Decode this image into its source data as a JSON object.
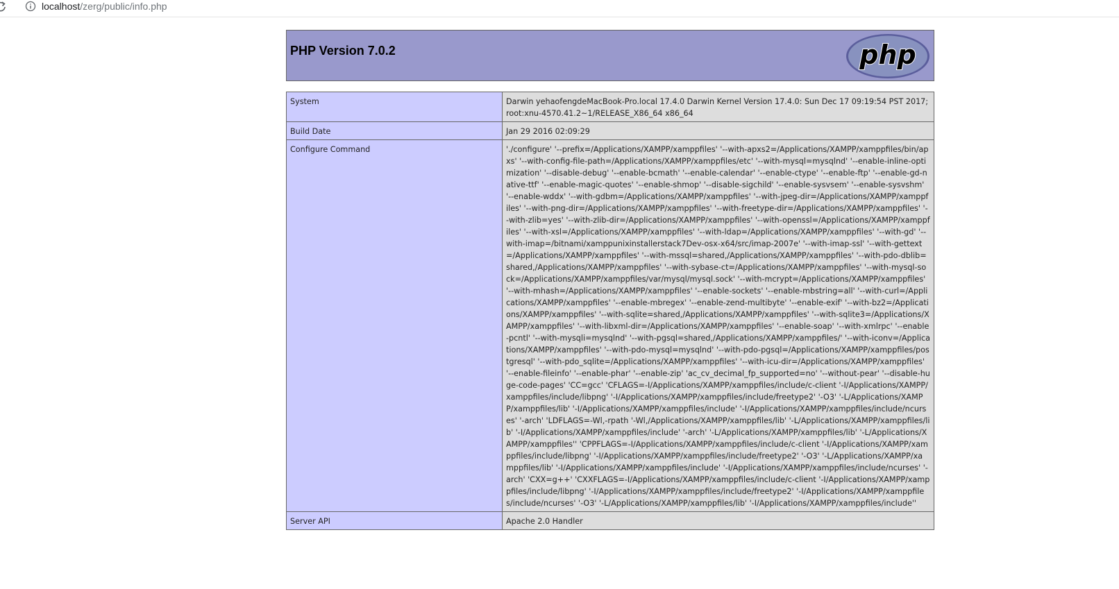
{
  "browser": {
    "url_host": "localhost",
    "url_path": "/zerg/public/info.php"
  },
  "header": {
    "title": "PHP Version 7.0.2",
    "logo_text": "php"
  },
  "rows": [
    {
      "key": "System",
      "value": "Darwin yehaofengdeMacBook-Pro.local 17.4.0 Darwin Kernel Version 17.4.0: Sun Dec 17 09:19:54 PST 2017; root:xnu-4570.41.2~1/RELEASE_X86_64 x86_64"
    },
    {
      "key": "Build Date",
      "value": "Jan 29 2016 02:09:29"
    },
    {
      "key": "Configure Command",
      "value": "'./configure' '--prefix=/Applications/XAMPP/xamppfiles' '--with-apxs2=/Applications/XAMPP/xamppfiles/bin/apxs' '--with-config-file-path=/Applications/XAMPP/xamppfiles/etc' '--with-mysql=mysqlnd' '--enable-inline-optimization' '--disable-debug' '--enable-bcmath' '--enable-calendar' '--enable-ctype' '--enable-ftp' '--enable-gd-native-ttf' '--enable-magic-quotes' '--enable-shmop' '--disable-sigchild' '--enable-sysvsem' '--enable-sysvshm' '--enable-wddx' '--with-gdbm=/Applications/XAMPP/xamppfiles' '--with-jpeg-dir=/Applications/XAMPP/xamppfiles' '--with-png-dir=/Applications/XAMPP/xamppfiles' '--with-freetype-dir=/Applications/XAMPP/xamppfiles' '--with-zlib=yes' '--with-zlib-dir=/Applications/XAMPP/xamppfiles' '--with-openssl=/Applications/XAMPP/xamppfiles' '--with-xsl=/Applications/XAMPP/xamppfiles' '--with-ldap=/Applications/XAMPP/xamppfiles' '--with-gd' '--with-imap=/bitnami/xamppunixinstallerstack7Dev-osx-x64/src/imap-2007e' '--with-imap-ssl' '--with-gettext=/Applications/XAMPP/xamppfiles' '--with-mssql=shared,/Applications/XAMPP/xamppfiles' '--with-pdo-dblib=shared,/Applications/XAMPP/xamppfiles' '--with-sybase-ct=/Applications/XAMPP/xamppfiles' '--with-mysql-sock=/Applications/XAMPP/xamppfiles/var/mysql/mysql.sock' '--with-mcrypt=/Applications/XAMPP/xamppfiles' '--with-mhash=/Applications/XAMPP/xamppfiles' '--enable-sockets' '--enable-mbstring=all' '--with-curl=/Applications/XAMPP/xamppfiles' '--enable-mbregex' '--enable-zend-multibyte' '--enable-exif' '--with-bz2=/Applications/XAMPP/xamppfiles' '--with-sqlite=shared,/Applications/XAMPP/xamppfiles' '--with-sqlite3=/Applications/XAMPP/xamppfiles' '--with-libxml-dir=/Applications/XAMPP/xamppfiles' '--enable-soap' '--with-xmlrpc' '--enable-pcntl' '--with-mysqli=mysqlnd' '--with-pgsql=shared,/Applications/XAMPP/xamppfiles/' '--with-iconv=/Applications/XAMPP/xamppfiles' '--with-pdo-mysql=mysqlnd' '--with-pdo-pgsql=/Applications/XAMPP/xamppfiles/postgresql' '--with-pdo_sqlite=/Applications/XAMPP/xamppfiles' '--with-icu-dir=/Applications/XAMPP/xamppfiles' '--enable-fileinfo' '--enable-phar' '--enable-zip' 'ac_cv_decimal_fp_supported=no' '--without-pear' '--disable-huge-code-pages' 'CC=gcc' 'CFLAGS=-I/Applications/XAMPP/xamppfiles/include/c-client '-I/Applications/XAMPP/xamppfiles/include/libpng' '-I/Applications/XAMPP/xamppfiles/include/freetype2' '-O3' '-L/Applications/XAMPP/xamppfiles/lib' '-I/Applications/XAMPP/xamppfiles/include' '-I/Applications/XAMPP/xamppfiles/include/ncurses' '-arch' 'LDFLAGS=-Wl,-rpath '-Wl,/Applications/XAMPP/xamppfiles/lib' '-L/Applications/XAMPP/xamppfiles/lib' '-I/Applications/XAMPP/xamppfiles/include' '-arch' '-L/Applications/XAMPP/xamppfiles/lib' '-L/Applications/XAMPP/xamppfiles'' 'CPPFLAGS=-I/Applications/XAMPP/xamppfiles/include/c-client '-I/Applications/XAMPP/xamppfiles/include/libpng' '-I/Applications/XAMPP/xamppfiles/include/freetype2' '-O3' '-L/Applications/XAMPP/xamppfiles/lib' '-I/Applications/XAMPP/xamppfiles/include' '-I/Applications/XAMPP/xamppfiles/include/ncurses' '-arch' 'CXX=g++' 'CXXFLAGS=-I/Applications/XAMPP/xamppfiles/include/c-client '-I/Applications/XAMPP/xamppfiles/include/libpng' '-I/Applications/XAMPP/xamppfiles/include/freetype2' '-I/Applications/XAMPP/xamppfiles/include/ncurses' '-O3' '-L/Applications/XAMPP/xamppfiles/lib' '-I/Applications/XAMPP/xamppfiles/include''"
    },
    {
      "key": "Server API",
      "value": "Apache 2.0 Handler"
    }
  ],
  "colors": {
    "header_bg": "#9999cc",
    "key_bg": "#ccccff",
    "value_bg": "#dddddd",
    "border": "#666666",
    "logo_fill": "#8892bf"
  }
}
